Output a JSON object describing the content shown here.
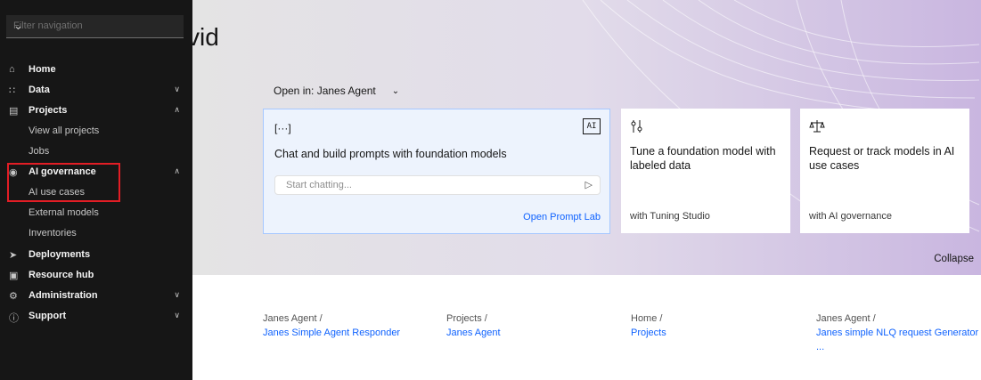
{
  "greeting_fragment": "vid",
  "open_in": {
    "label": "Open in: Janes Agent"
  },
  "cards": [
    {
      "icon": "[···]",
      "title": "Chat and build prompts with foundation models",
      "input_placeholder": "Start chatting...",
      "link": "Open Prompt Lab",
      "badge": "AI"
    },
    {
      "icon": "tune-icon",
      "title": "Tune a foundation model with labeled data",
      "footer": "with Tuning Studio"
    },
    {
      "icon": "balance-icon",
      "title": "Request or track models in AI use cases",
      "footer": "with AI governance"
    }
  ],
  "collapse_label": "Collapse",
  "recent": [
    {
      "path": "Janes Agent /",
      "name": "Janes Simple Agent Responder"
    },
    {
      "path": "Projects /",
      "name": "Janes Agent"
    },
    {
      "path": "Home /",
      "name": "Projects"
    },
    {
      "path": "Janes Agent /",
      "name": "Janes simple NLQ request Generator ..."
    }
  ],
  "sidebar": {
    "filter_placeholder": "Filter navigation",
    "items": [
      {
        "label": "Home",
        "icon": "home-icon"
      },
      {
        "label": "Data",
        "icon": "data-icon"
      },
      {
        "label": "Projects",
        "icon": "projects-icon"
      },
      {
        "label": "View all projects"
      },
      {
        "label": "Jobs"
      },
      {
        "label": "AI governance",
        "icon": "governance-icon"
      },
      {
        "label": "AI use cases"
      },
      {
        "label": "External models"
      },
      {
        "label": "Inventories"
      },
      {
        "label": "Deployments",
        "icon": "rocket-icon"
      },
      {
        "label": "Resource hub",
        "icon": "resource-icon"
      },
      {
        "label": "Administration",
        "icon": "admin-icon"
      },
      {
        "label": "Support",
        "icon": "support-icon"
      }
    ]
  },
  "colors": {
    "link": "#0f62fe",
    "sidebar_bg": "#161616",
    "highlight": "#e21d25"
  }
}
